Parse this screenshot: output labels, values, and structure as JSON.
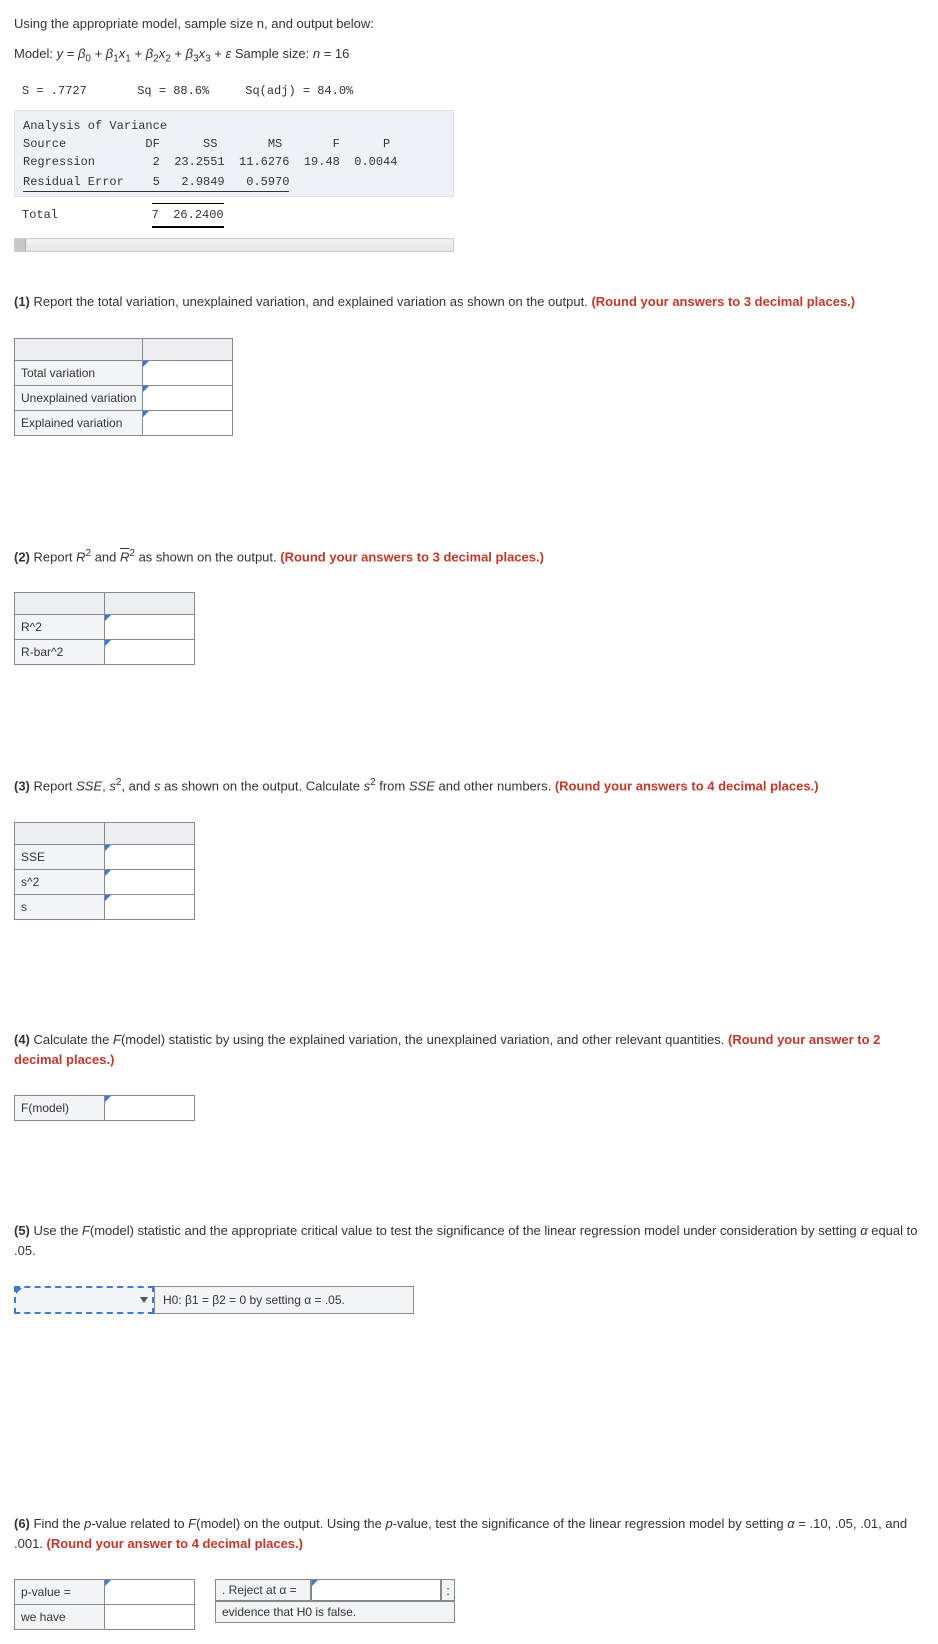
{
  "intro": "Using the appropriate model, sample size n, and output below:",
  "model_prefix": "Model: ",
  "model_formula_plain": "y = β0 + β1x1 + β2x2 + β3x3 + ε",
  "sample_size_label": " Sample size: ",
  "sample_size_expr": "n = 16",
  "stats_line": "S = .7727       Sq = 88.6%     Sq(adj) = 84.0%",
  "anova": {
    "title": "Analysis of Variance",
    "header": "Source           DF      SS       MS       F      P",
    "regression": "Regression        2  23.2551  11.6276  19.48  0.0044",
    "residual": "Residual Error    5   2.9849   0.5970",
    "total_label": "Total             7  26.2400",
    "total_df": "7",
    "total_ss": "26.2400"
  },
  "q1": {
    "num": "(1)",
    "text_a": " Report the total variation, unexplained variation, and explained variation as shown on the output. ",
    "text_b": "(Round your answers to 3 decimal places.)",
    "rows": [
      "Total variation",
      "Unexplained variation",
      "Explained variation"
    ]
  },
  "q2": {
    "num": "(2)",
    "text_a": " Report ",
    "r2": "R",
    "text_mid": " and ",
    "text_b": "  as shown on the output. ",
    "text_c": "(Round your answers to 3 decimal places.)",
    "rows": [
      "R^2",
      "R-bar^2"
    ]
  },
  "q3": {
    "num": "(3)",
    "text_a": " Report ",
    "sse": "SSE",
    "comma": ", ",
    "s2": "s",
    "text_b": ", and ",
    "s": "s",
    "text_c": " as shown on the output. Calculate ",
    "text_d": " from ",
    "text_e": " and other numbers. ",
    "text_f": "(Round your answers to 4 decimal places.)",
    "rows": [
      "SSE",
      "s^2",
      "s"
    ]
  },
  "q4": {
    "num": "(4)",
    "text_a": " Calculate the ",
    "fmodel": "F",
    "fmodel2": "(model) statistic by using the explained variation, the unexplained variation, and other relevant quantities. ",
    "text_b": "(Round your answer to 2 decimal places.)",
    "row": "F(model)"
  },
  "q5": {
    "num": "(5)",
    "text_a": " Use the ",
    "text_b": "(model) statistic and the appropriate critical value to test the significance of the linear regression model under consideration by setting ",
    "alpha": "α",
    "text_c": " equal to .05.",
    "hypo": "H0: β1 = β2 = 0 by setting α = .05."
  },
  "q6": {
    "num": "(6)",
    "text_a": " Find the ",
    "pval": "p",
    "text_b": "-value related to ",
    "text_c": "(model) on the output. Using the ",
    "text_d": "-value, test the significance of the linear regression model by setting ",
    "text_e": " = .10, .05, .01, and .001. ",
    "text_f": "(Round your answer to 4 decimal places.)",
    "rows_left": [
      "p-value =",
      "we have"
    ],
    "rej_label": ". Reject at α =",
    "ev_label": "evidence that H0 is false."
  }
}
